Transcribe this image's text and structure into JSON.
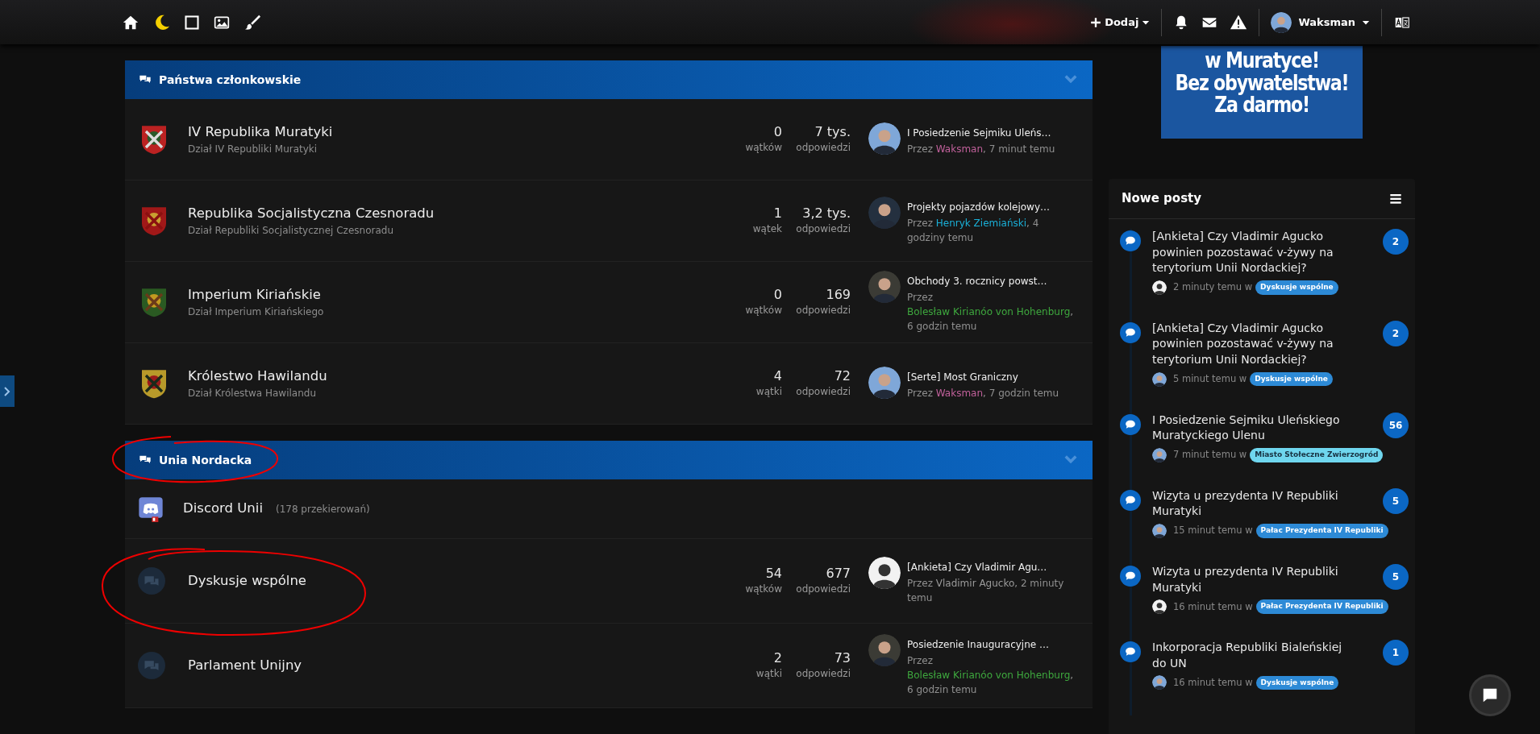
{
  "topbar": {
    "add_label": "Dodaj",
    "user": "Waksman"
  },
  "banner": {
    "lines": [
      "w Muratyce!",
      "Bez obywatelstwa!",
      "Za darmo!"
    ]
  },
  "categories": [
    {
      "title": "Państwa członkowskie",
      "forums": [
        {
          "kind": "emblem",
          "title": "IV Republika Muratyki",
          "description": "Dział IV Republiki Muratyki",
          "threads": "0",
          "threads_label": "wątków",
          "posts": "7 tys.",
          "posts_label": "odpowiedzi",
          "last_post": {
            "title": "I Posiedzenie Sejmiku Uleńs…",
            "by": "Przez",
            "author": "Waksman",
            "color": "#c0609a",
            "time": ", 7 minut temu"
          }
        },
        {
          "kind": "emblem",
          "title": "Republika Socjalistyczna Czesnoradu",
          "description": "Dział Republiki Socjalistycznej Czesnoradu",
          "threads": "1",
          "threads_label": "wątek",
          "posts": "3,2 tys.",
          "posts_label": "odpowiedzi",
          "last_post": {
            "title": "Projekty pojazdów kolejowy…",
            "by": "Przez",
            "author": "Henryk Ziemiański",
            "color": "#1ab0d8",
            "time": ", 4 godziny temu"
          }
        },
        {
          "kind": "emblem",
          "title": "Imperium Kiriańskie",
          "description": "Dział Imperium Kiriańskiego",
          "threads": "0",
          "threads_label": "wątków",
          "posts": "169",
          "posts_label": "odpowiedzi",
          "last_post": {
            "title": "Obchody 3. rocznicy powst…",
            "by": "Przez",
            "author": "Bolesław Kirianóo von Hohenburg",
            "color": "#3ea83e",
            "time": ", 6 godzin temu"
          }
        },
        {
          "kind": "emblem",
          "title": "Królestwo Hawilandu",
          "description": "Dział Królestwa Hawilandu",
          "threads": "4",
          "threads_label": "wątki",
          "posts": "72",
          "posts_label": "odpowiedzi",
          "last_post": {
            "title": "[Serte] Most Graniczny",
            "by": "Przez",
            "author": "Waksman",
            "color": "#c0609a",
            "time": ", 7 godzin temu"
          }
        }
      ]
    },
    {
      "title": "Unia Nordacka",
      "forums": [
        {
          "kind": "link",
          "title": "Discord Unii",
          "redirects": "(178 przekierowań)"
        },
        {
          "kind": "forum",
          "title": "Dyskusje wspólne",
          "threads": "54",
          "threads_label": "wątków",
          "posts": "677",
          "posts_label": "odpowiedzi",
          "last_post": {
            "title": "[Ankieta] Czy Vladimir Agu…",
            "by": "Przez",
            "author": "Vladimir Agucko",
            "color": "#9a9a9a",
            "time": ", 2 minuty temu"
          }
        },
        {
          "kind": "forum",
          "title": "Parlament Unijny",
          "threads": "2",
          "threads_label": "wątki",
          "posts": "73",
          "posts_label": "odpowiedzi",
          "last_post": {
            "title": "Posiedzenie Inauguracyjne …",
            "by": "Przez",
            "author": "Bolesław Kirianóo von Hohenburg",
            "color": "#3ea83e",
            "time": ", 6 godzin temu"
          }
        }
      ]
    }
  ],
  "new_posts": {
    "title": "Nowe posty",
    "posts": [
      {
        "title": "[Ankieta] Czy Vladimir Agucko powinien pozostawać v-żywy na terytorium Unii Nordackiej?",
        "time": "2 minuty temu w",
        "forum": "Dyskusje wspólne",
        "color": "#2d8ad6",
        "count": "2"
      },
      {
        "title": "[Ankieta] Czy Vladimir Agucko powinien pozostawać v-żywy na terytorium Unii Nordackiej?",
        "time": "5 minut temu w",
        "forum": "Dyskusje wspólne",
        "color": "#2d8ad6",
        "count": "2"
      },
      {
        "title": "I Posiedzenie Sejmiku Uleńskiego Muratyckiego Ulenu",
        "time": "7 minut temu w",
        "forum": "Miasto Stołeczne Zwierzogród",
        "color": "#6fd6ee",
        "count": "56"
      },
      {
        "title": "Wizyta u prezydenta IV Republiki Muratyki",
        "time": "15 minut temu w",
        "forum": "Pałac Prezydenta IV Republiki",
        "color": "#2d8ad6",
        "count": "5"
      },
      {
        "title": "Wizyta u prezydenta IV Republiki Muratyki",
        "time": "16 minut temu w",
        "forum": "Pałac Prezydenta IV Republiki",
        "color": "#2d8ad6",
        "count": "5"
      },
      {
        "title": "Inkorporacja Republiki Bialeńskiej do UN",
        "time": "16 minut temu w",
        "forum": "Dyskusje wspólne",
        "color": "#2d8ad6",
        "count": "1"
      }
    ]
  }
}
